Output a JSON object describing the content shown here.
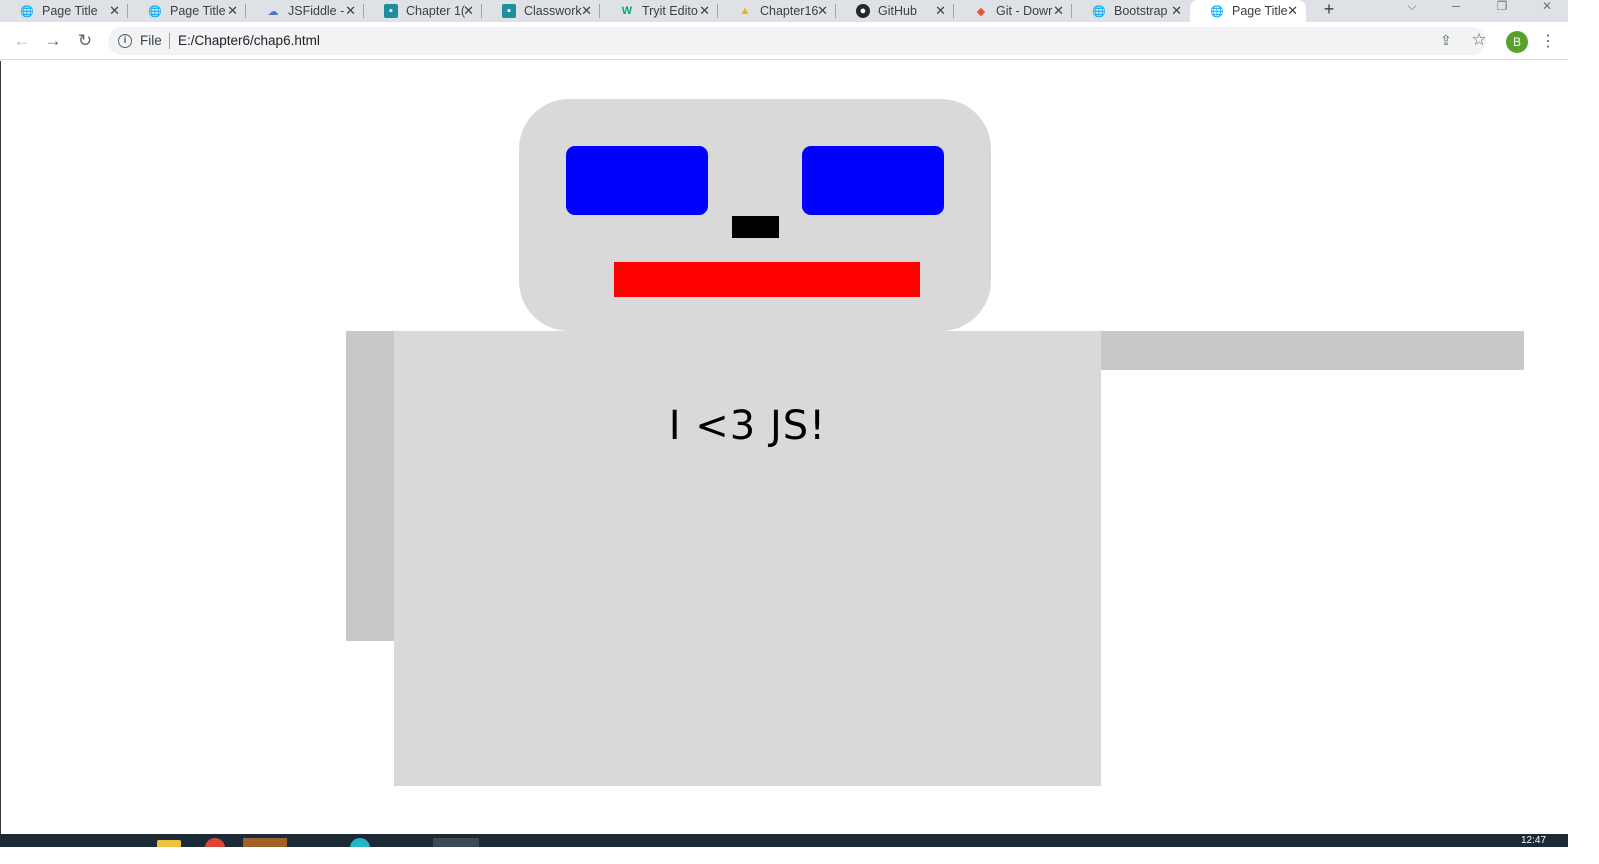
{
  "browser": {
    "tabs": [
      {
        "label": "Page Title",
        "icon": "globe-icon",
        "active": false
      },
      {
        "label": "Page Title",
        "icon": "globe-icon",
        "active": false
      },
      {
        "label": "JSFiddle -",
        "icon": "jsfiddle-icon",
        "active": false
      },
      {
        "label": "Chapter 1(",
        "icon": "classroom-icon",
        "active": false
      },
      {
        "label": "Classwork",
        "icon": "classroom-icon",
        "active": false
      },
      {
        "label": "Tryit Edito",
        "icon": "w3schools-icon",
        "active": false
      },
      {
        "label": "Chapter16",
        "icon": "google-drive-icon",
        "active": false
      },
      {
        "label": "GitHub",
        "icon": "github-icon",
        "active": false
      },
      {
        "label": "Git - Dowr",
        "icon": "git-icon",
        "active": false
      },
      {
        "label": "Bootstrap",
        "icon": "globe-icon",
        "active": false
      },
      {
        "label": "Page Title",
        "icon": "globe-icon",
        "active": true
      }
    ],
    "new_tab_symbol": "+",
    "address_bar": {
      "scheme_label": "File",
      "url": "E:/Chapter6/chap6.html"
    },
    "profile_initial": "B",
    "colors": {
      "profile": "#5aa02c",
      "tabstrip": "#dee1e6"
    }
  },
  "page": {
    "slogan": "I <3 JS!",
    "colors": {
      "head": "#d9d9d9",
      "eyes": "#0000ff",
      "nose": "#000000",
      "mouth": "#ff0000",
      "arms": "#c8c8c8",
      "body": "#d9d9d9"
    }
  },
  "taskbar": {
    "clock": "12:47"
  }
}
